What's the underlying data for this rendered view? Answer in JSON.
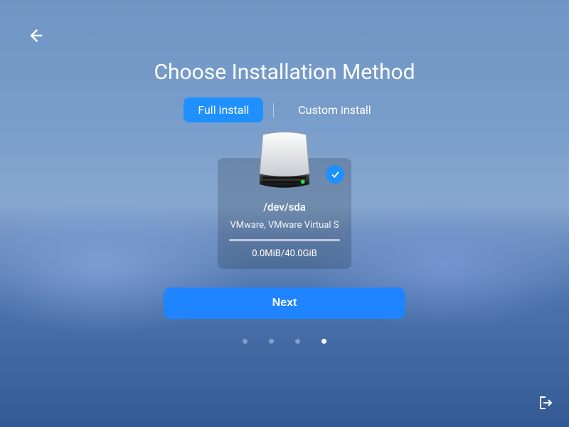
{
  "title": "Choose Installation Method",
  "tabs": {
    "full": "Full install",
    "custom": "Custom install"
  },
  "disk": {
    "device": "/dev/sda",
    "model": "VMware, VMware Virtual S",
    "usage": "0.0MiB/40.0GiB"
  },
  "next_label": "Next",
  "pager": {
    "count": 4,
    "active_index": 3
  }
}
